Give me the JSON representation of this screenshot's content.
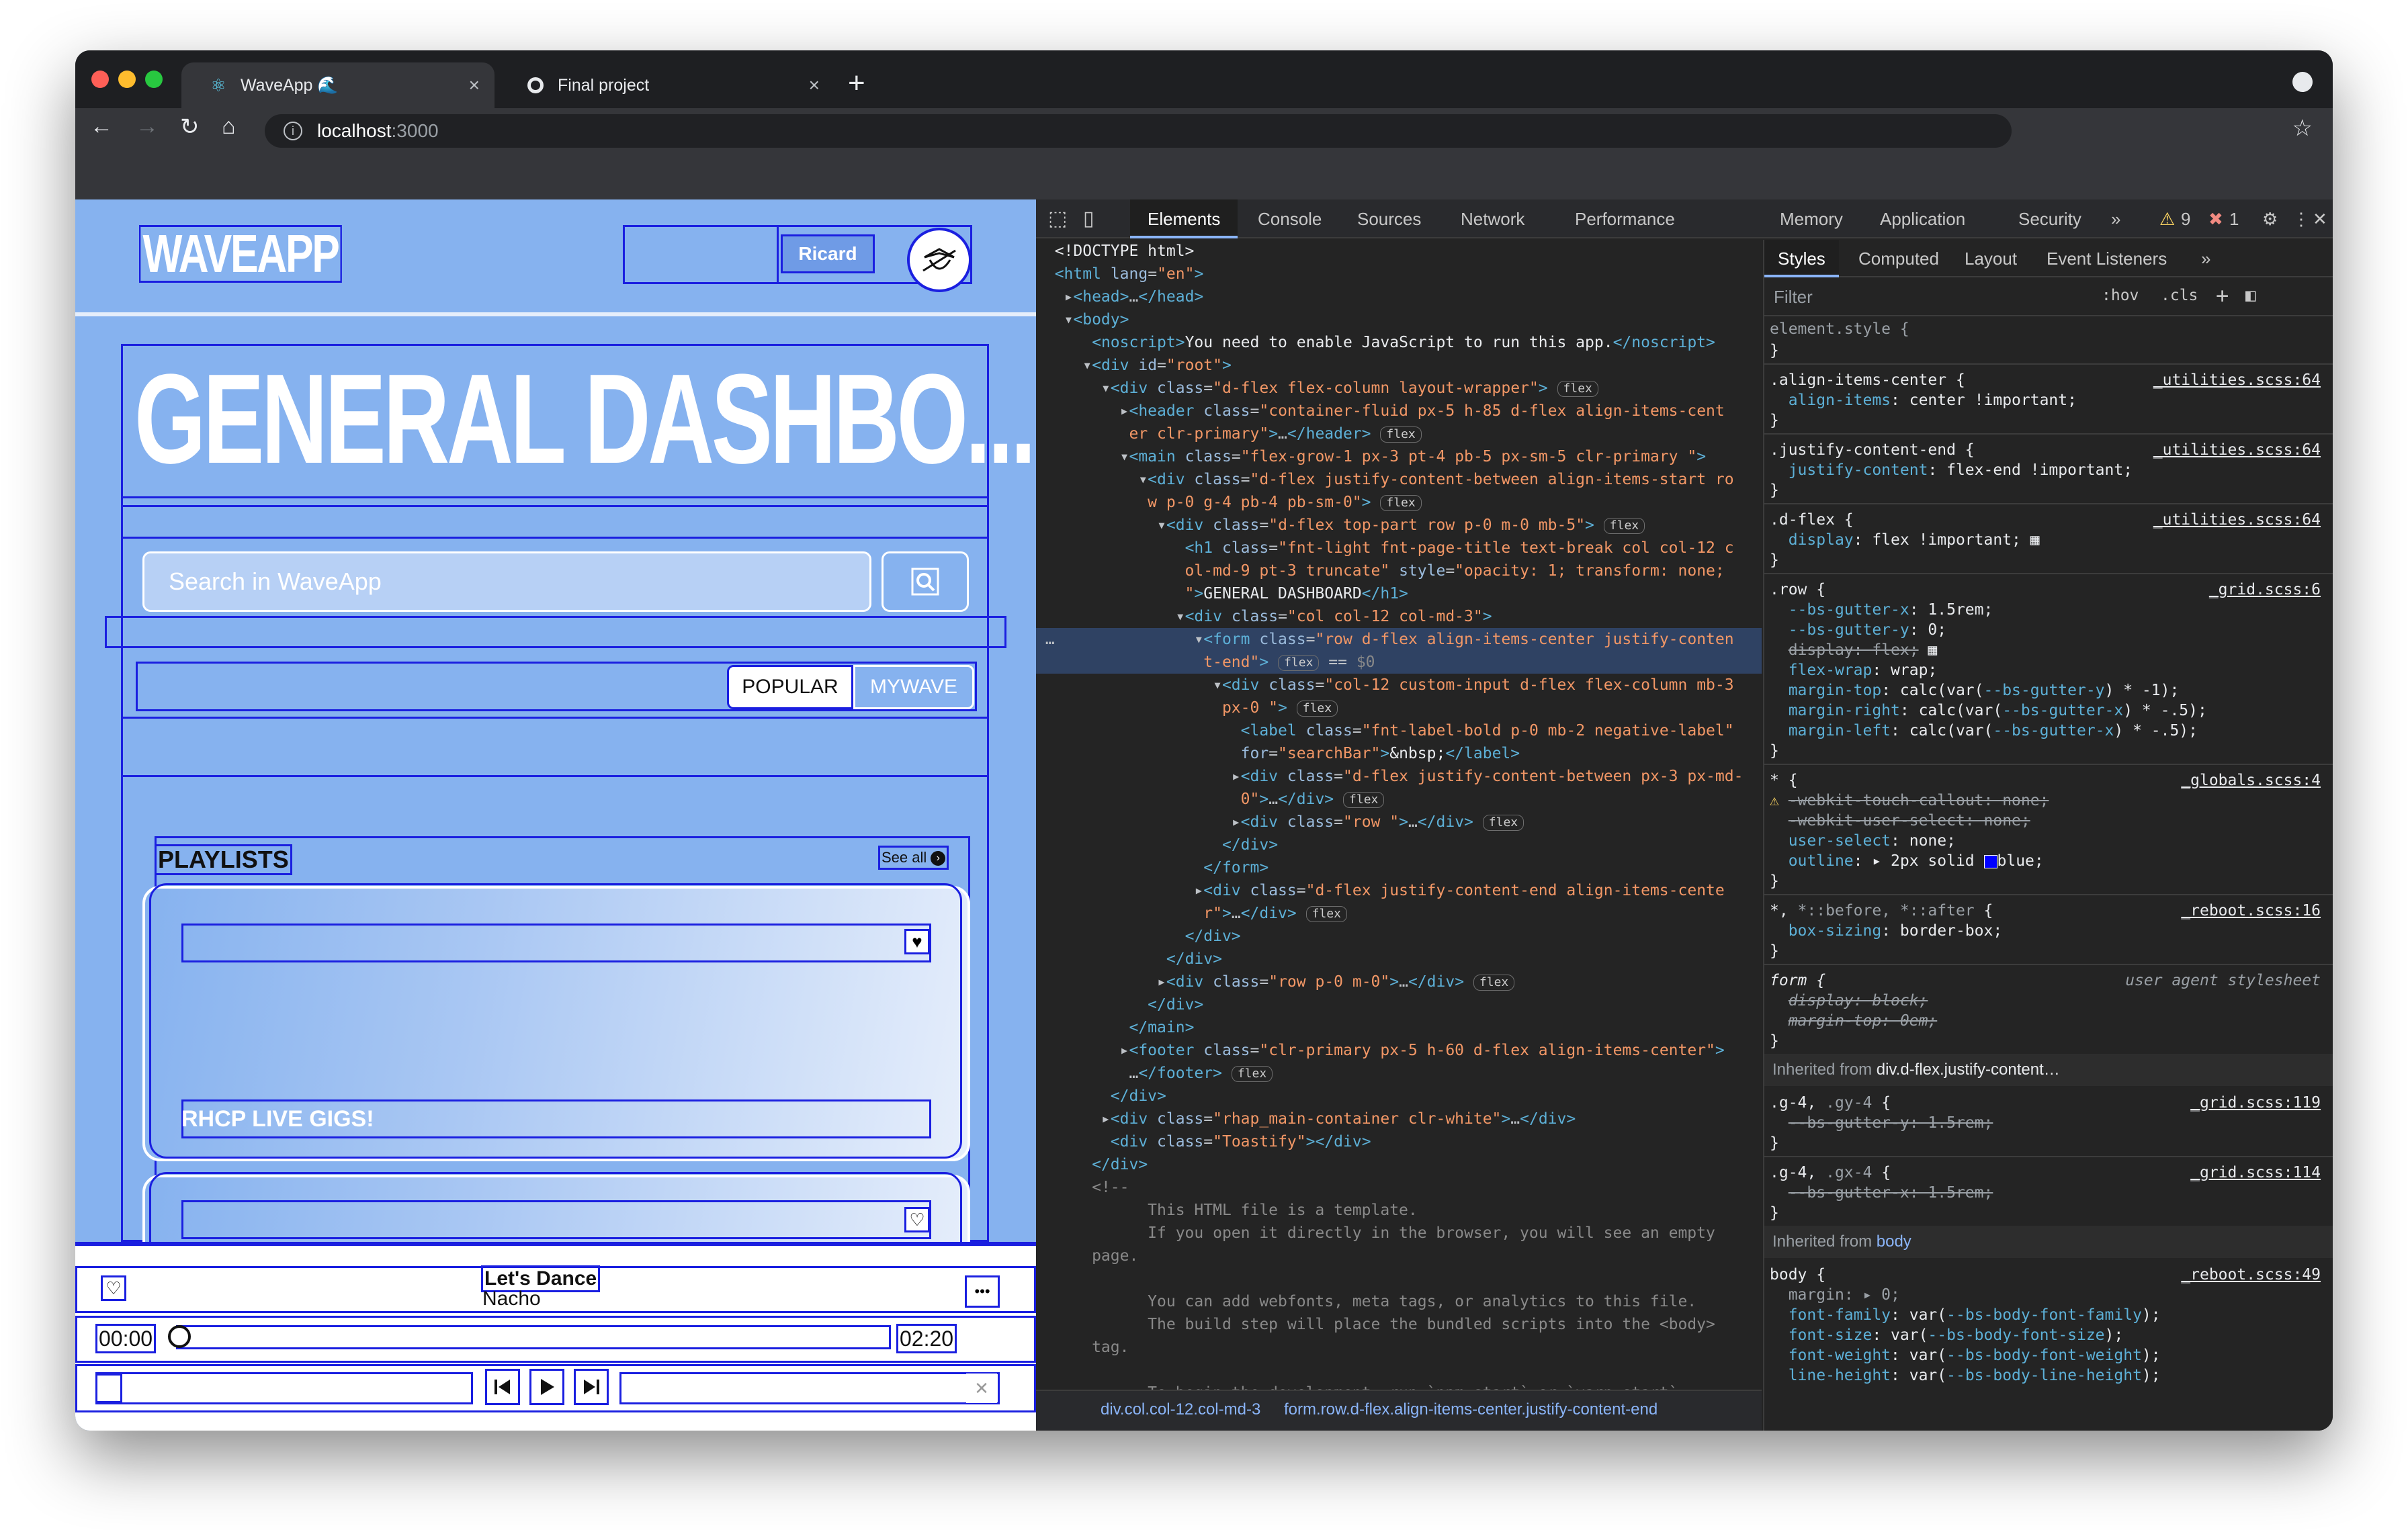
{
  "browser": {
    "tabs": [
      {
        "title": "WaveApp 🌊",
        "favicon": "react-icon",
        "active": true
      },
      {
        "title": "Final project",
        "favicon": "github-icon",
        "active": false
      }
    ],
    "url_host": "localhost",
    "url_port": ":3000"
  },
  "app": {
    "logo": "WAVEAPP",
    "user": "Ricard",
    "page_title": "GENERAL DASHBO...",
    "search_placeholder": "Search in WaveApp",
    "feed_tabs": [
      "POPULAR",
      "MYWAVE"
    ],
    "playlists_title": "PLAYLISTS",
    "see_all": "See all",
    "playlists": [
      {
        "title": "RHCP LIVE GIGS!"
      },
      {
        "title": ""
      }
    ],
    "player": {
      "track": "Let's Dance",
      "artist": "Nacho",
      "current": "00:00",
      "duration": "02:20",
      "progress": 0.0
    }
  },
  "devtools": {
    "tabs": [
      "Elements",
      "Console",
      "Sources",
      "Network",
      "Performance",
      "Memory",
      "Application",
      "Security"
    ],
    "warnings": "9",
    "errors": "1",
    "breadcrumb": [
      "div.col.col-12.col-md-3",
      "form.row.d-flex.align-items-center.justify-content-end"
    ],
    "style_tabs": [
      "Styles",
      "Computed",
      "Layout",
      "Event Listeners"
    ],
    "filter_placeholder": "Filter",
    "hov": ":hov",
    "cls": ".cls",
    "inherited": [
      "Inherited from",
      "div.d-flex.justify-content…",
      "body"
    ]
  },
  "colors": {
    "app_bg": "#86b2ef",
    "outline": "#1a1fe0",
    "devtools_bg": "#242424",
    "highlight": "#2f4263"
  }
}
